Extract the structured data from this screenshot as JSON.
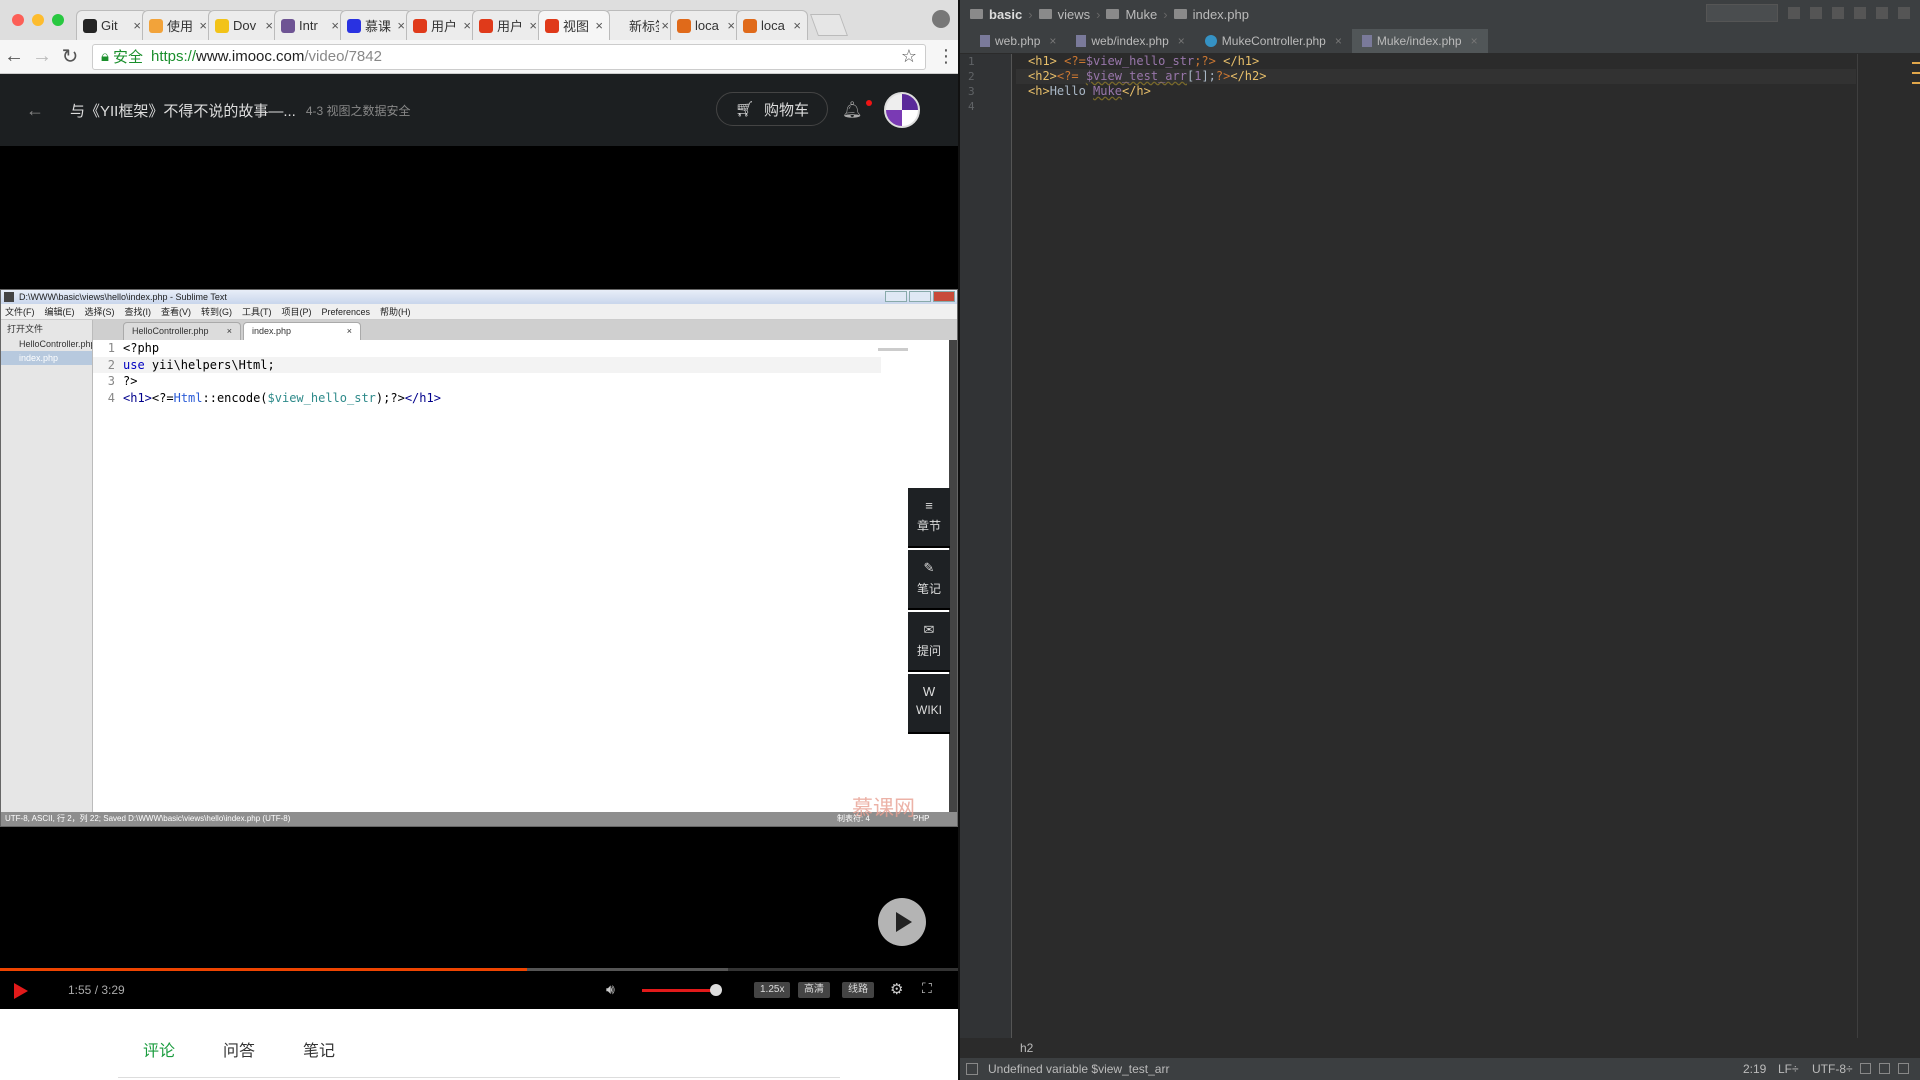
{
  "browser": {
    "tabs": [
      {
        "label": "Git",
        "fav": "github-icon",
        "color": "#222222"
      },
      {
        "label": "使用",
        "fav": "chat-icon",
        "color": "#f2a33a"
      },
      {
        "label": "Dov",
        "fav": "download-icon",
        "color": "#f2c318"
      },
      {
        "label": "Intr",
        "fav": "octocat-icon",
        "color": "#6e5494"
      },
      {
        "label": "慕课",
        "fav": "paw-icon",
        "color": "#2932e1"
      },
      {
        "label": "用户",
        "fav": "flame-icon",
        "color": "#e03a1a"
      },
      {
        "label": "用户",
        "fav": "flame-icon",
        "color": "#e03a1a"
      },
      {
        "label": "视图",
        "fav": "flame-icon",
        "color": "#e03a1a"
      },
      {
        "label": "新标签",
        "fav": "",
        "color": ""
      },
      {
        "label": "loca",
        "fav": "xampp-icon",
        "color": "#e06a1a"
      },
      {
        "label": "loca",
        "fav": "xampp-icon",
        "color": "#e06a1a"
      }
    ],
    "secure_label": "安全",
    "url_proto": "https://",
    "url_host": "www.imooc.com",
    "url_path": "/video/7842"
  },
  "imooc": {
    "title": "与《YII框架》不得不说的故事—...",
    "subtitle": "4-3 视图之数据安全",
    "cart_label": "购物车"
  },
  "sublime": {
    "window_title": "D:\\WWW\\basic\\views\\hello\\index.php - Sublime Text",
    "menu": [
      "文件(F)",
      "编辑(E)",
      "选择(S)",
      "查找(I)",
      "查看(V)",
      "转到(G)",
      "工具(T)",
      "项目(P)",
      "Preferences",
      "帮助(H)"
    ],
    "side_header": "打开文件",
    "side_files": [
      "HelloController.php",
      "index.php"
    ],
    "tabs": [
      "HelloController.php",
      "index.php"
    ],
    "code": [
      {
        "n": "1",
        "segments": [
          [
            "",
            "<?php"
          ]
        ]
      },
      {
        "n": "2",
        "segments": [
          [
            "kw",
            "use"
          ],
          [
            "",
            " yii\\helpers\\Html;"
          ]
        ]
      },
      {
        "n": "3",
        "segments": [
          [
            "",
            "?>"
          ]
        ]
      },
      {
        "n": "4",
        "segments": [
          [
            "tag",
            "<h1>"
          ],
          [
            "",
            "<?="
          ],
          [
            "cls",
            "Html"
          ],
          [
            "",
            "::encode("
          ],
          [
            "var",
            "$view_hello_str"
          ],
          [
            "",
            ");?>"
          ],
          [
            "tag",
            "</h1>"
          ]
        ]
      }
    ],
    "status_left": "UTF-8, ASCII, 行 2，列 22; Saved D:\\WWW\\basic\\views\\hello\\index.php (UTF-8)",
    "status_tab": "制表符: 4",
    "status_syntax": "PHP",
    "watermark": "慕课网"
  },
  "video_side": [
    {
      "icon": "≡",
      "name": "chapters-icon",
      "label": "章节"
    },
    {
      "icon": "✎",
      "name": "note-icon",
      "label": "笔记"
    },
    {
      "icon": "✉",
      "name": "question-icon",
      "label": "提问"
    },
    {
      "icon": "W",
      "name": "wiki-icon",
      "label": "WIKI"
    }
  ],
  "player": {
    "time": "1:55 / 3:29",
    "progress": 0.55,
    "buffered": 0.76,
    "volume": 0.9,
    "speed": "1.25x",
    "quality": "高清",
    "route": "线路"
  },
  "comments_tabs": [
    "评论",
    "问答",
    "笔记"
  ],
  "phpstorm": {
    "breadcrumb": [
      "basic",
      "views",
      "Muke",
      "index.php"
    ],
    "tabs": [
      {
        "label": "web.php",
        "icon": "file",
        "active": false
      },
      {
        "label": "web/index.php",
        "icon": "file",
        "active": false
      },
      {
        "label": "MukeController.php",
        "icon": "class",
        "active": false
      },
      {
        "label": "Muke/index.php",
        "icon": "file",
        "active": true
      }
    ],
    "lines": [
      "1",
      "2",
      "3",
      "4"
    ],
    "code": [
      [
        [
          "t",
          "<h1>"
        ],
        [
          "",
          " "
        ],
        [
          "op",
          "<?="
        ],
        [
          "v",
          "$view_hello_str"
        ],
        [
          "op",
          ";?>"
        ],
        [
          "",
          " "
        ],
        [
          "t",
          "</h1>"
        ]
      ],
      [
        [
          "t",
          "<h2>"
        ],
        [
          "op",
          "<?="
        ],
        [
          "",
          " "
        ],
        [
          "pv",
          "$view_test_arr"
        ],
        [
          "",
          "["
        ],
        [
          "v",
          "1"
        ],
        [
          "",
          "];"
        ],
        [
          "op",
          "?>"
        ],
        [
          "t",
          "</h2>"
        ]
      ],
      [
        [
          "t",
          "<h>"
        ],
        [
          "",
          "Hello "
        ],
        [
          "pv",
          "Muke"
        ],
        [
          "t",
          "</h>"
        ]
      ],
      []
    ],
    "bottom_tag": "h2",
    "status_msg": "Undefined variable $view_test_arr",
    "position": "2:19",
    "line_sep": "LF÷",
    "encoding": "UTF-8÷"
  }
}
